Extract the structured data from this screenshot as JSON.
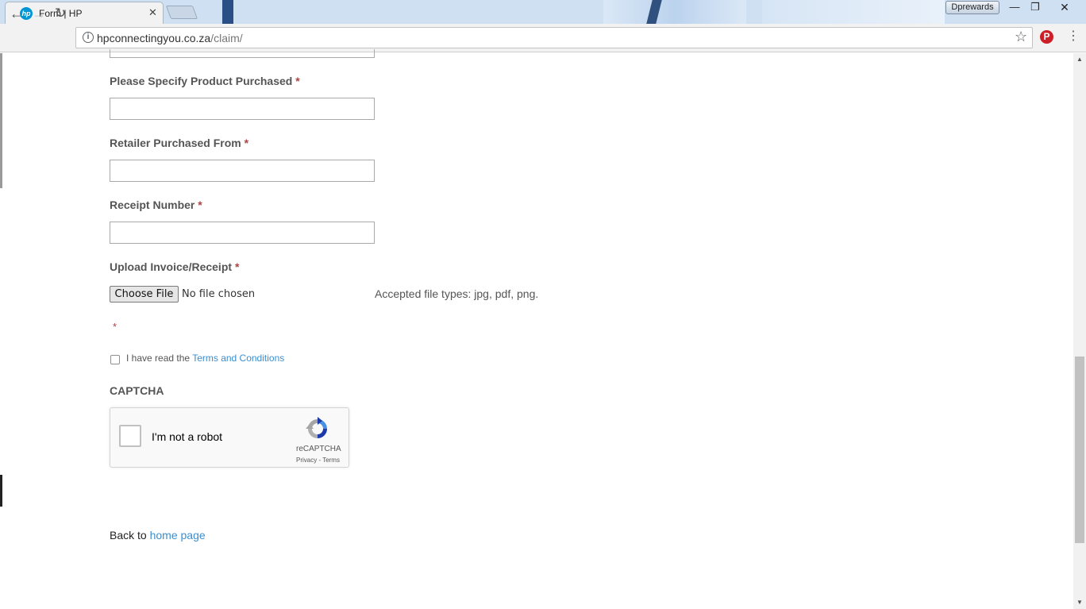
{
  "browser": {
    "tab_title": "Form | HP",
    "tab_favicon_text": "hp",
    "tab_close": "✕",
    "profile_button": "Dprewards",
    "window_minimize": "—",
    "window_maximize": "❐",
    "window_close": "✕",
    "nav_back": "←",
    "nav_forward": "→",
    "nav_reload": "↻",
    "info_glyph": "i",
    "url_host": "hpconnectingyou.co.za",
    "url_path": "/claim/",
    "star_glyph": "☆",
    "pinterest_glyph": "P",
    "menu_glyph": "⋮"
  },
  "form": {
    "product_label": "Please Specify Product Purchased",
    "retailer_label": "Retailer Purchased From",
    "receipt_label": "Receipt Number",
    "upload_label": "Upload Invoice/Receipt",
    "required_mark": "*",
    "product_value": "",
    "retailer_value": "",
    "receipt_value": "",
    "choose_file_button": "Choose File",
    "file_status": "No file chosen",
    "accepted_types": "Accepted file types: jpg, pdf, png.",
    "terms_prefix": "I have read the ",
    "terms_link": "Terms and Conditions",
    "captcha_heading": "CAPTCHA",
    "captcha_checkbox_label": "I'm not a robot",
    "captcha_brand": "reCAPTCHA",
    "captcha_links": "Privacy - Terms",
    "back_prefix": "Back to ",
    "back_link": "home page"
  },
  "scrollbar": {
    "up_arrow": "▲",
    "down_arrow": "▼"
  },
  "colors": {
    "link": "#3a8fcf",
    "required": "#a94442",
    "label": "#555555",
    "pinterest": "#cb2027",
    "hp_blue": "#0096d6"
  }
}
